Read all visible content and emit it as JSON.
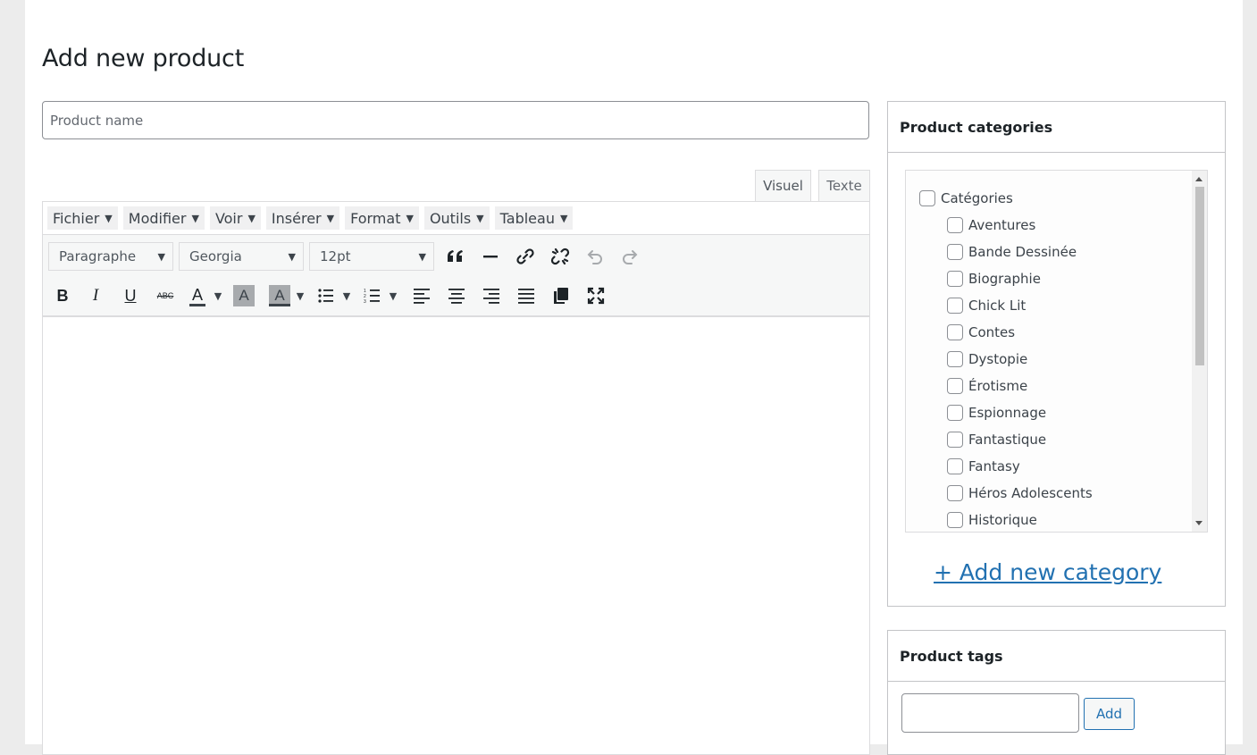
{
  "page": {
    "title": "Add new product"
  },
  "product_name": {
    "placeholder": "Product name",
    "value": ""
  },
  "editor": {
    "tabs": [
      {
        "label": "Visuel"
      },
      {
        "label": "Texte"
      }
    ],
    "menus": [
      {
        "label": "Fichier"
      },
      {
        "label": "Modifier"
      },
      {
        "label": "Voir"
      },
      {
        "label": "Insérer"
      },
      {
        "label": "Format"
      },
      {
        "label": "Outils"
      },
      {
        "label": "Tableau"
      }
    ],
    "block_format": "Paragraphe",
    "font_family": "Georgia",
    "font_size": "12pt",
    "strikethrough_glyph": "ABC",
    "color_glyph": "A",
    "icons": {
      "quote": "blockquote-icon",
      "hr": "horizontal-line-icon",
      "link": "link-icon",
      "unlink": "unlink-icon",
      "undo": "undo-icon",
      "redo": "redo-icon",
      "bold": "bold-icon",
      "italic": "italic-icon",
      "underline": "underline-icon",
      "strikethrough": "strikethrough-icon",
      "text_color": "text-color-icon",
      "bg_color": "background-color-icon",
      "bullets": "bullet-list-icon",
      "numbers": "numbered-list-icon",
      "align_left": "align-left-icon",
      "align_center": "align-center-icon",
      "align_right": "align-right-icon",
      "justify": "justify-icon",
      "paste": "paste-icon",
      "fullscreen": "fullscreen-icon"
    },
    "colors": {
      "text_color_bar": "#3c434a",
      "bg_color_fill": "#a7aaad"
    }
  },
  "categories": {
    "title": "Product categories",
    "root": "Catégories",
    "items": [
      "Aventures",
      "Bande Dessinée",
      "Biographie",
      "Chick Lit",
      "Contes",
      "Dystopie",
      "Érotisme",
      "Espionnage",
      "Fantastique",
      "Fantasy",
      "Héros Adolescents",
      "Historique"
    ],
    "add_link": "+ Add new category"
  },
  "tags": {
    "title": "Product tags",
    "input_value": "",
    "add_label": "Add"
  },
  "theme": {
    "accent": "#2271b1",
    "border": "#c3c4c7",
    "background": "#ececec"
  }
}
